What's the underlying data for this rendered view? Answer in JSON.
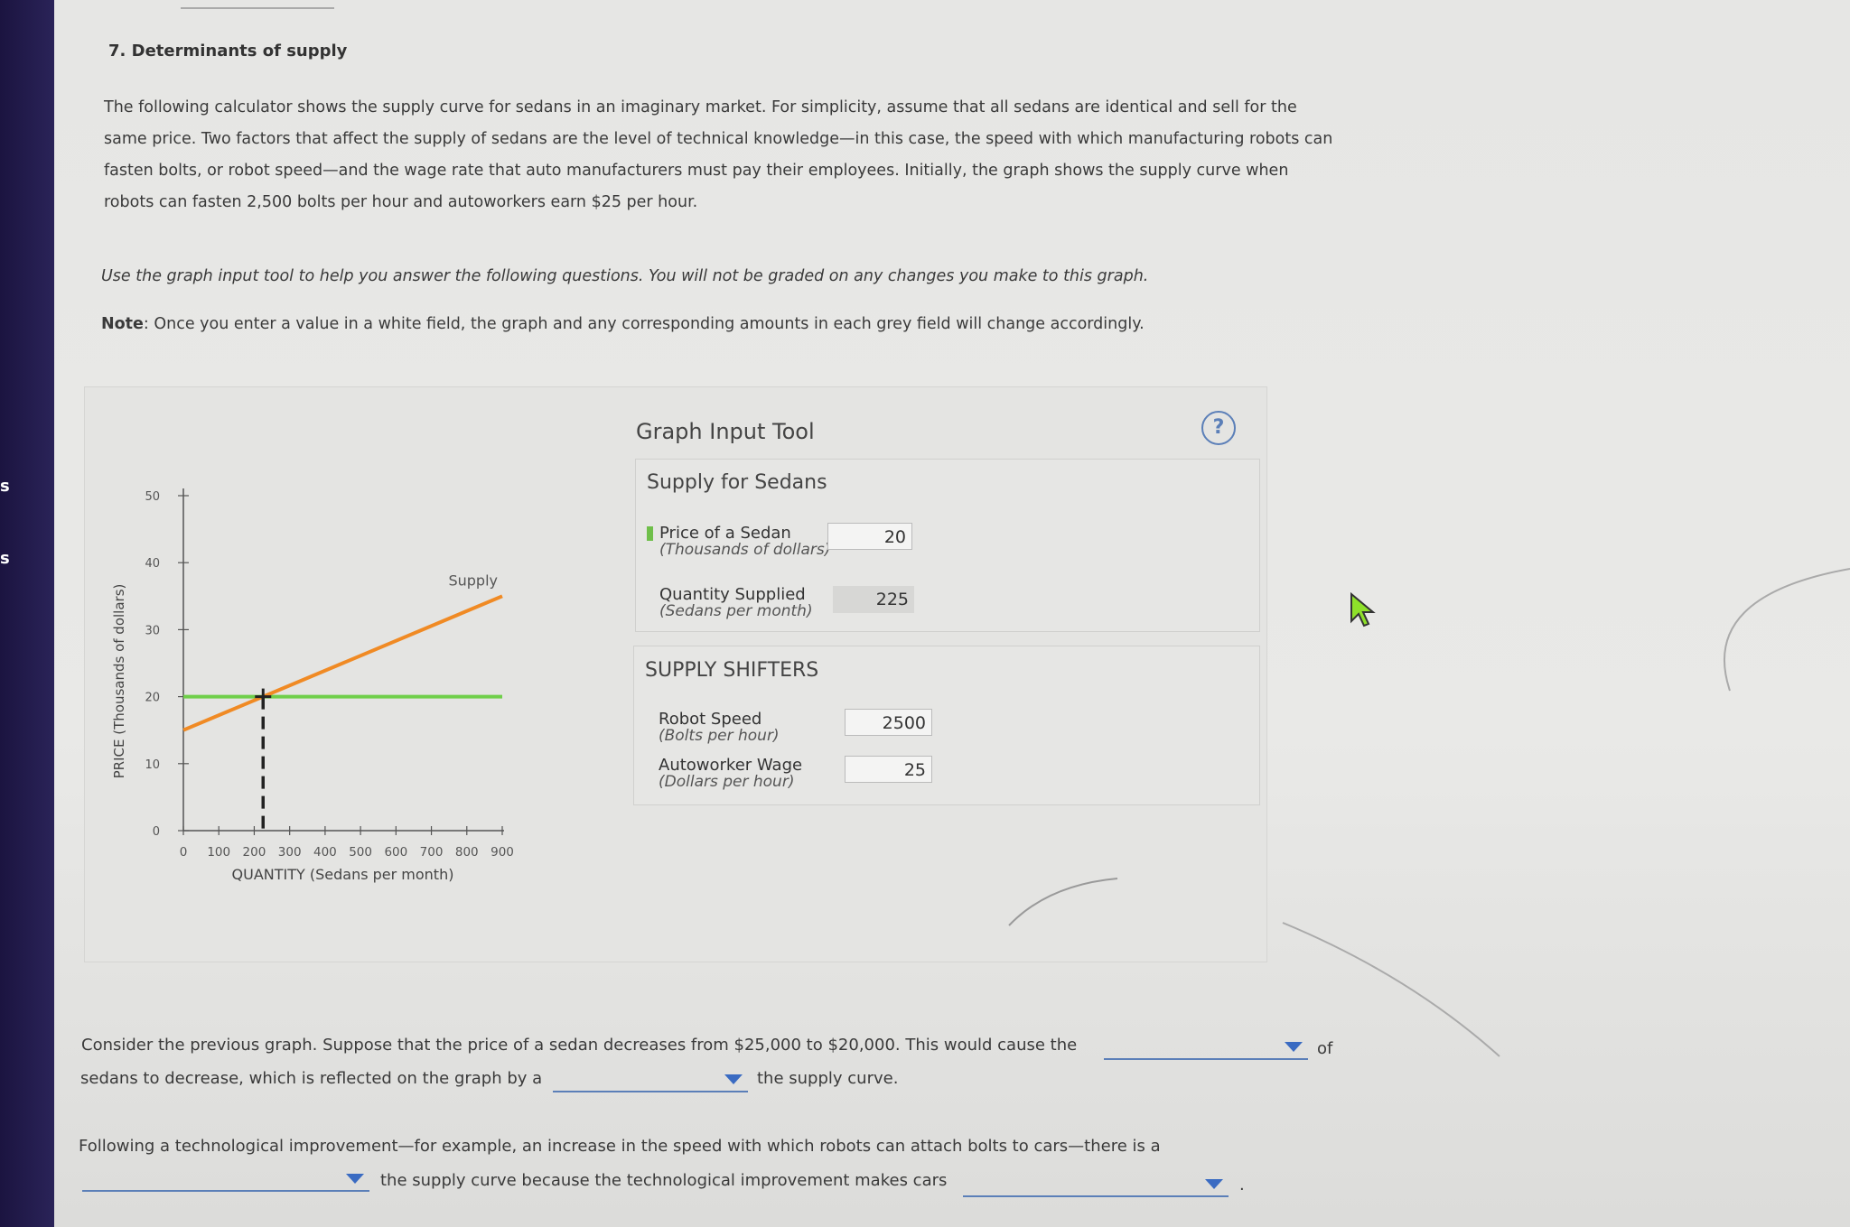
{
  "sidebar": {
    "text_a": "s",
    "text_b": "s"
  },
  "question": {
    "title": "7. Determinants of supply",
    "paragraph": "The following calculator shows the supply curve for sedans in an imaginary market. For simplicity, assume that all sedans are identical and sell for the same price. Two factors that affect the supply of sedans are the level of technical knowledge—in this case, the speed with which manufacturing robots can fasten bolts, or robot speed—and the wage rate that auto manufacturers must pay their employees. Initially, the graph shows the supply curve when robots can fasten 2,500 bolts per hour and autoworkers earn $25 per hour.",
    "instruction": "Use the graph input tool to help you answer the following questions. You will not be graded on any changes you make to this graph.",
    "note_label": "Note",
    "note_text": ": Once you enter a value in a white field, the graph and any corresponding amounts in each grey field will change accordingly."
  },
  "chart_data": {
    "type": "line",
    "xlabel": "QUANTITY (Sedans per month)",
    "ylabel": "PRICE (Thousands of dollars)",
    "xlim": [
      0,
      900
    ],
    "ylim": [
      0,
      50
    ],
    "x_ticks": [
      0,
      100,
      200,
      300,
      400,
      500,
      600,
      700,
      800,
      900
    ],
    "y_ticks": [
      0,
      10,
      20,
      30,
      40,
      50
    ],
    "series": [
      {
        "name": "Supply",
        "color": "#f08a24",
        "x": [
          0,
          900
        ],
        "y": [
          15,
          35
        ]
      }
    ],
    "price_line": {
      "y": 20,
      "color": "#6fcf4a"
    },
    "point": {
      "x": 225,
      "y": 20
    }
  },
  "tool": {
    "title": "Graph Input Tool",
    "help_icon": "question-circle-icon",
    "supply_title": "Supply for Sedans",
    "price_label": "Price of a Sedan",
    "price_sub": "(Thousands of dollars)",
    "price_value": "20",
    "qty_label": "Quantity Supplied",
    "qty_sub": "(Sedans per month)",
    "qty_value": "225",
    "shifters_title": "SUPPLY SHIFTERS",
    "robot_label": "Robot Speed",
    "robot_sub": "(Bolts per hour)",
    "robot_value": "2500",
    "wage_label": "Autoworker Wage",
    "wage_sub": "(Dollars per hour)",
    "wage_value": "25"
  },
  "q1": {
    "part1": "Consider the previous graph. Suppose that the price of a sedan decreases from $25,000 to $20,000. This would cause the",
    "part2": "of",
    "part3": "sedans to decrease, which is reflected on the graph by a",
    "part4": "the supply curve."
  },
  "q2": {
    "part1": "Following a technological improvement—for example, an increase in the speed with which robots can attach bolts to cars—there is a",
    "part2": "the supply curve because the technological improvement makes cars",
    "part3": "."
  }
}
